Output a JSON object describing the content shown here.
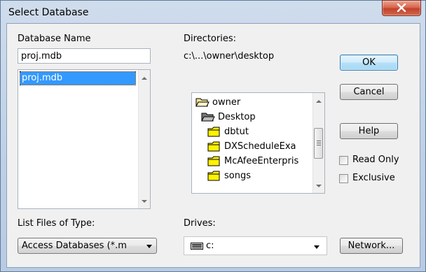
{
  "window": {
    "title": "Select Database"
  },
  "database_name": {
    "label": "Database Name",
    "value": "proj.mdb",
    "files": [
      "proj.mdb"
    ]
  },
  "directories": {
    "label": "Directories:",
    "path": "c:\\...\\owner\\desktop",
    "items": [
      {
        "name": "owner",
        "icon": "folder-open-icon"
      },
      {
        "name": "Desktop",
        "icon": "folder-open-icon"
      },
      {
        "name": "dbtut",
        "icon": "folder-icon"
      },
      {
        "name": "DXScheduleExa",
        "icon": "folder-icon"
      },
      {
        "name": "McAfeeEnterpris",
        "icon": "folder-icon"
      },
      {
        "name": "songs",
        "icon": "folder-icon"
      }
    ]
  },
  "buttons": {
    "ok": "OK",
    "cancel": "Cancel",
    "help": "Help",
    "network": "Network..."
  },
  "options": {
    "read_only": {
      "label": "Read Only",
      "checked": false
    },
    "exclusive": {
      "label": "Exclusive",
      "checked": false
    }
  },
  "file_type": {
    "label": "List Files of Type:",
    "value": "Access Databases (*.m"
  },
  "drives": {
    "label": "Drives:",
    "value": "c:"
  },
  "colors": {
    "selection": "#3399ff",
    "close_button": "#c7452e"
  }
}
